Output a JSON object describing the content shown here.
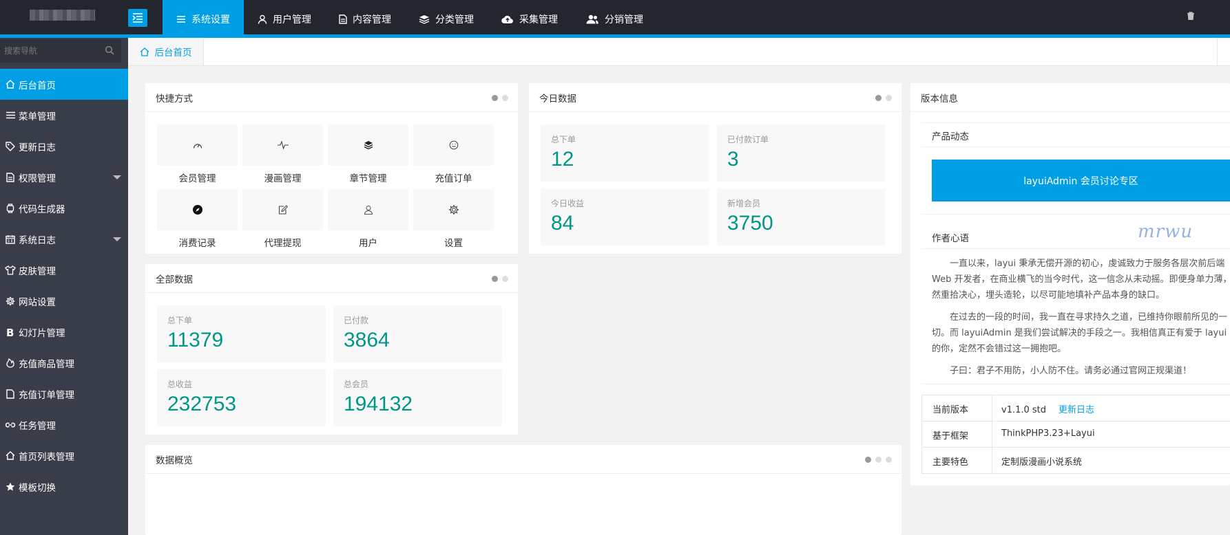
{
  "topbar": {
    "nav": [
      {
        "label": "系统设置",
        "icon": "list-icon",
        "active": true
      },
      {
        "label": "用户管理",
        "icon": "user-icon",
        "active": false
      },
      {
        "label": "内容管理",
        "icon": "document-icon",
        "active": false
      },
      {
        "label": "分类管理",
        "icon": "layers-icon",
        "active": false
      },
      {
        "label": "采集管理",
        "icon": "cloud-upload-icon",
        "active": false
      },
      {
        "label": "分销管理",
        "icon": "users-icon",
        "active": false
      }
    ],
    "accent_color": "#009fe5"
  },
  "sidebar": {
    "search_placeholder": "搜索导航",
    "items": [
      {
        "label": "后台首页",
        "icon": "home-icon",
        "active": true,
        "expandable": false
      },
      {
        "label": "菜单管理",
        "icon": "menu-icon",
        "active": false,
        "expandable": false
      },
      {
        "label": "更新日志",
        "icon": "tag-icon",
        "active": false,
        "expandable": false
      },
      {
        "label": "权限管理",
        "icon": "document-icon",
        "active": false,
        "expandable": true
      },
      {
        "label": "代码生成器",
        "icon": "watch-icon",
        "active": false,
        "expandable": false
      },
      {
        "label": "系统日志",
        "icon": "calendar-icon",
        "active": false,
        "expandable": true
      },
      {
        "label": "皮肤管理",
        "icon": "shirt-icon",
        "active": false,
        "expandable": false
      },
      {
        "label": "网站设置",
        "icon": "gear-icon",
        "active": false,
        "expandable": false
      },
      {
        "label": "幻灯片管理",
        "icon": "bold-b-icon",
        "active": false,
        "expandable": false
      },
      {
        "label": "充值商品管理",
        "icon": "fire-icon",
        "active": false,
        "expandable": false
      },
      {
        "label": "充值订单管理",
        "icon": "file-icon",
        "active": false,
        "expandable": false
      },
      {
        "label": "任务管理",
        "icon": "link-icon",
        "active": false,
        "expandable": false
      },
      {
        "label": "首页列表管理",
        "icon": "home-outline-icon",
        "active": false,
        "expandable": false
      },
      {
        "label": "模板切换",
        "icon": "star-icon",
        "active": false,
        "expandable": false
      }
    ]
  },
  "tabs": [
    {
      "label": "后台首页"
    }
  ],
  "shortcuts": {
    "title": "快捷方式",
    "items": [
      {
        "label": "会员管理",
        "icon": "gauge-icon"
      },
      {
        "label": "漫画管理",
        "icon": "pulse-icon"
      },
      {
        "label": "章节管理",
        "icon": "layers-icon"
      },
      {
        "label": "充值订单",
        "icon": "smile-icon"
      },
      {
        "label": "消费记录",
        "icon": "compass-icon"
      },
      {
        "label": "代理提现",
        "icon": "edit-icon"
      },
      {
        "label": "用户",
        "icon": "user-icon"
      },
      {
        "label": "设置",
        "icon": "gear-icon"
      }
    ]
  },
  "today": {
    "title": "今日数据",
    "stats": [
      {
        "label": "总下单",
        "value": "12"
      },
      {
        "label": "已付款订单",
        "value": "3"
      },
      {
        "label": "今日收益",
        "value": "84"
      },
      {
        "label": "新增会员",
        "value": "3750"
      }
    ]
  },
  "all": {
    "title": "全部数据",
    "stats": [
      {
        "label": "总下单",
        "value": "11379"
      },
      {
        "label": "已付款",
        "value": "3864"
      },
      {
        "label": "总收益",
        "value": "232753"
      },
      {
        "label": "总会员",
        "value": "194132"
      }
    ]
  },
  "overview": {
    "title": "数据概览"
  },
  "version": {
    "title": "版本信息",
    "product_title": "产品动态",
    "banner": "layuiAdmin 会员讨论专区",
    "author_title": "作者心语",
    "signature": "mrwu",
    "paragraphs": [
      [
        "一直以来，layui 秉承无偿开源的初心，虔诚致力于服务各层次前后端",
        "Web 开发者，在商业横飞的当今时代，这一信念从未动摇。即便身单力薄，也",
        "然重拾决心，埋头造轮，以尽可能地填补产品本身的缺口。"
      ],
      [
        "在过去的一段的时间，我一直在寻求持久之道，已维持你眼前所见的一",
        "切。而 layuiAdmin 是我们尝试解决的手段之一。我相信真正有爱于 layui",
        "的你，定然不会错过这一拥抱吧。"
      ],
      [
        "子曰：君子不用防，小人防不住。请务必通过官网正规渠道！"
      ]
    ],
    "rows": [
      {
        "key": "当前版本",
        "value": "v1.1.0 std",
        "link": "更新日志"
      },
      {
        "key": "基于框架",
        "value": "ThinkPHP3.23+Layui",
        "link": ""
      },
      {
        "key": "主要特色",
        "value": "定制版漫画小说系统",
        "link": ""
      }
    ]
  }
}
